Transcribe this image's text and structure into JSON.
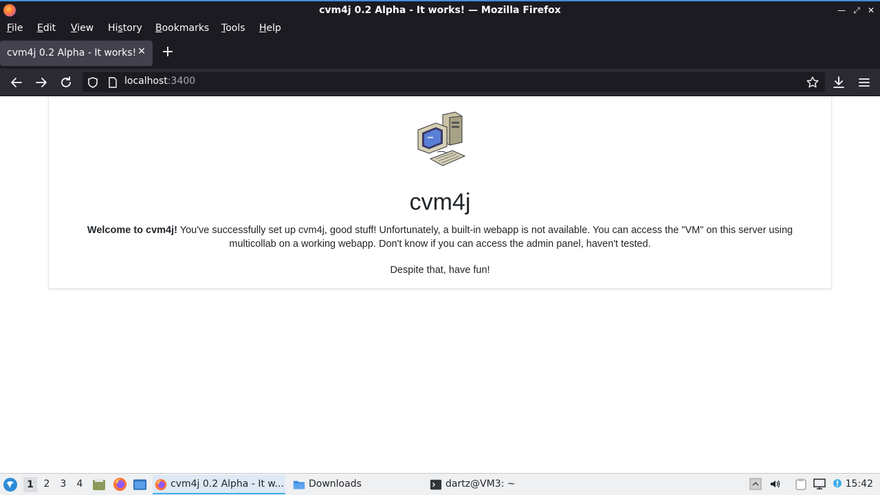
{
  "window": {
    "title": "cvm4j 0.2 Alpha - It works! — Mozilla Firefox",
    "controls": {
      "minimize": "—",
      "maximize": "⤢",
      "close": "✕"
    }
  },
  "menu": {
    "items": [
      {
        "pre": "",
        "u": "F",
        "post": "ile"
      },
      {
        "pre": "",
        "u": "E",
        "post": "dit"
      },
      {
        "pre": "",
        "u": "V",
        "post": "iew"
      },
      {
        "pre": "Hi",
        "u": "s",
        "post": "tory"
      },
      {
        "pre": "",
        "u": "B",
        "post": "ookmarks"
      },
      {
        "pre": "",
        "u": "T",
        "post": "ools"
      },
      {
        "pre": "",
        "u": "H",
        "post": "elp"
      }
    ]
  },
  "tabs": [
    {
      "label": "cvm4j 0.2 Alpha - It works!",
      "close": "✕"
    }
  ],
  "newtab": "+",
  "nav": {
    "url_host": "localhost",
    "url_port": ":3400"
  },
  "page": {
    "heading": "cvm4j",
    "welcome_bold": "Welcome to cvm4j!",
    "welcome_text": " You've successfully set up cvm4j, good stuff! Unfortunately, a built-in webapp is not available. You can access the \"VM\" on this server using multicollab on a working webapp. Don't know if you can access the admin panel, haven't tested.",
    "closing": "Despite that, have fun!"
  },
  "taskbar": {
    "desktops": [
      "1",
      "2",
      "3",
      "4"
    ],
    "active_desktop": "1",
    "tasks": [
      {
        "label": "cvm4j 0.2 Alpha - It w...",
        "icon": "firefox-icon",
        "active": true
      },
      {
        "label": "Downloads",
        "icon": "folder-icon",
        "active": false
      },
      {
        "label": "dartz@VM3: ~",
        "icon": "terminal-icon",
        "active": false
      }
    ],
    "clock": "15:42"
  },
  "colors": {
    "accent": "#3daee9",
    "chrome_dark": "#1c1b22",
    "toolbar": "#2b2a33",
    "tab_active": "#42414d"
  }
}
